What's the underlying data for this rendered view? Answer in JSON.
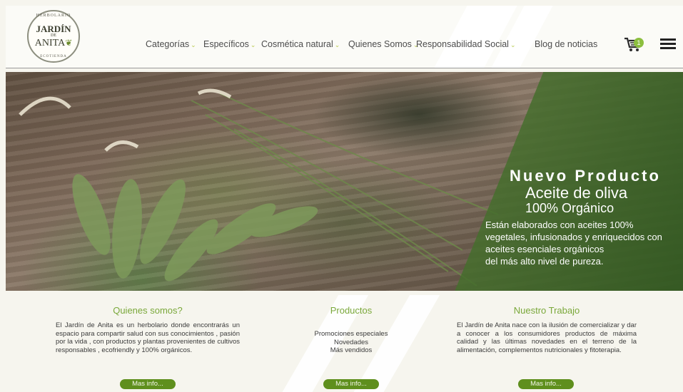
{
  "logo": {
    "arc_top": "HERBOLARIO",
    "line1": "JARDÍN",
    "line2": "DE",
    "line3": "ANITA",
    "arc_bottom": "ECOTIENDA"
  },
  "nav": [
    {
      "label": "Categorías",
      "caret": true
    },
    {
      "label": "Específicos",
      "caret": true
    },
    {
      "label": "Cosmética natural",
      "caret": true
    },
    {
      "label": "Quienes Somos",
      "caret": true
    },
    {
      "label": "Responsabilidad Social",
      "caret": true
    },
    {
      "label": "Blog de noticias",
      "caret": false
    }
  ],
  "cart": {
    "count": "1",
    "icon": "cart-icon"
  },
  "menu_icon": "hamburger-menu-icon",
  "hero": {
    "title": "Nuevo Producto",
    "subtitle": "Aceite de oliva",
    "subtitle2": "100% Orgánico",
    "description": [
      "Están elaborados con aceites 100%",
      "vegetales, infusionados y enriquecidos con",
      "aceites esenciales orgánicos",
      "del más alto nivel de pureza."
    ]
  },
  "sections": {
    "about": {
      "title": "Quienes somos?",
      "text": "El Jardín de Anita es un herbolario donde encontrarás un espacio para compartir salud con sus conocimientos , pasión por la vida , con productos y plantas provenientes de cultivos responsables , ecofriendly y 100% orgánicos.",
      "button": "Mas info..."
    },
    "products": {
      "title": "Productos",
      "items": [
        "Promociones especiales",
        "Novedades",
        "Más vendidos"
      ],
      "button": "Mas info..."
    },
    "work": {
      "title": "Nuestro Trabajo",
      "text": "El Jardín de Anita nace con la ilusión de comercializar y dar a conocer a los consumidores productos de máxima calidad y las últimas novedades en el terreno de la alimentación, complementos nutricionales y fitoterapia.",
      "button": "Mas info..."
    }
  },
  "colors": {
    "accent_green": "#7aa83a",
    "button_green": "#5f8f1d",
    "background": "#f6f5ee"
  }
}
